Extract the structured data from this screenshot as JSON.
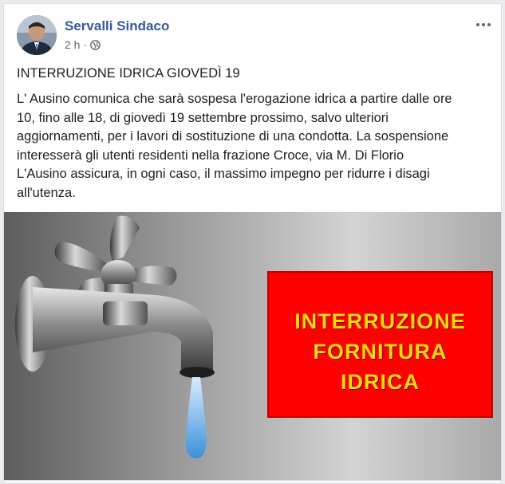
{
  "post": {
    "author": "Servalli Sindaco",
    "time": "2 h",
    "time_separator": "·",
    "privacy_icon": "globe-icon",
    "more_icon": "more-options-icon",
    "title": "INTERRUZIONE IDRICA GIOVEDÌ 19",
    "body": "L' Ausino comunica che sarà sospesa l'erogazione idrica a partire dalle ore\n10, fino alle 18, di giovedì 19 settembre prossimo, salvo ulteriori\naggiornamenti, per i lavori di sostituzione di una condotta. La sospensione\ninteresserà gli utenti residenti nella frazione Croce, via M. Di Florio\nL'Ausino assicura, in ogni caso, il massimo impegno per ridurre i disagi\nall'utenza.",
    "image": {
      "sign_lines": [
        "INTERRUZIONE",
        "FORNITURA",
        "IDRICA"
      ],
      "sign_color": "#ff0000",
      "text_color": "#f6d90f"
    }
  },
  "colors": {
    "author_link": "#385898",
    "meta_text": "#606770",
    "body_text": "#1c1e21"
  }
}
